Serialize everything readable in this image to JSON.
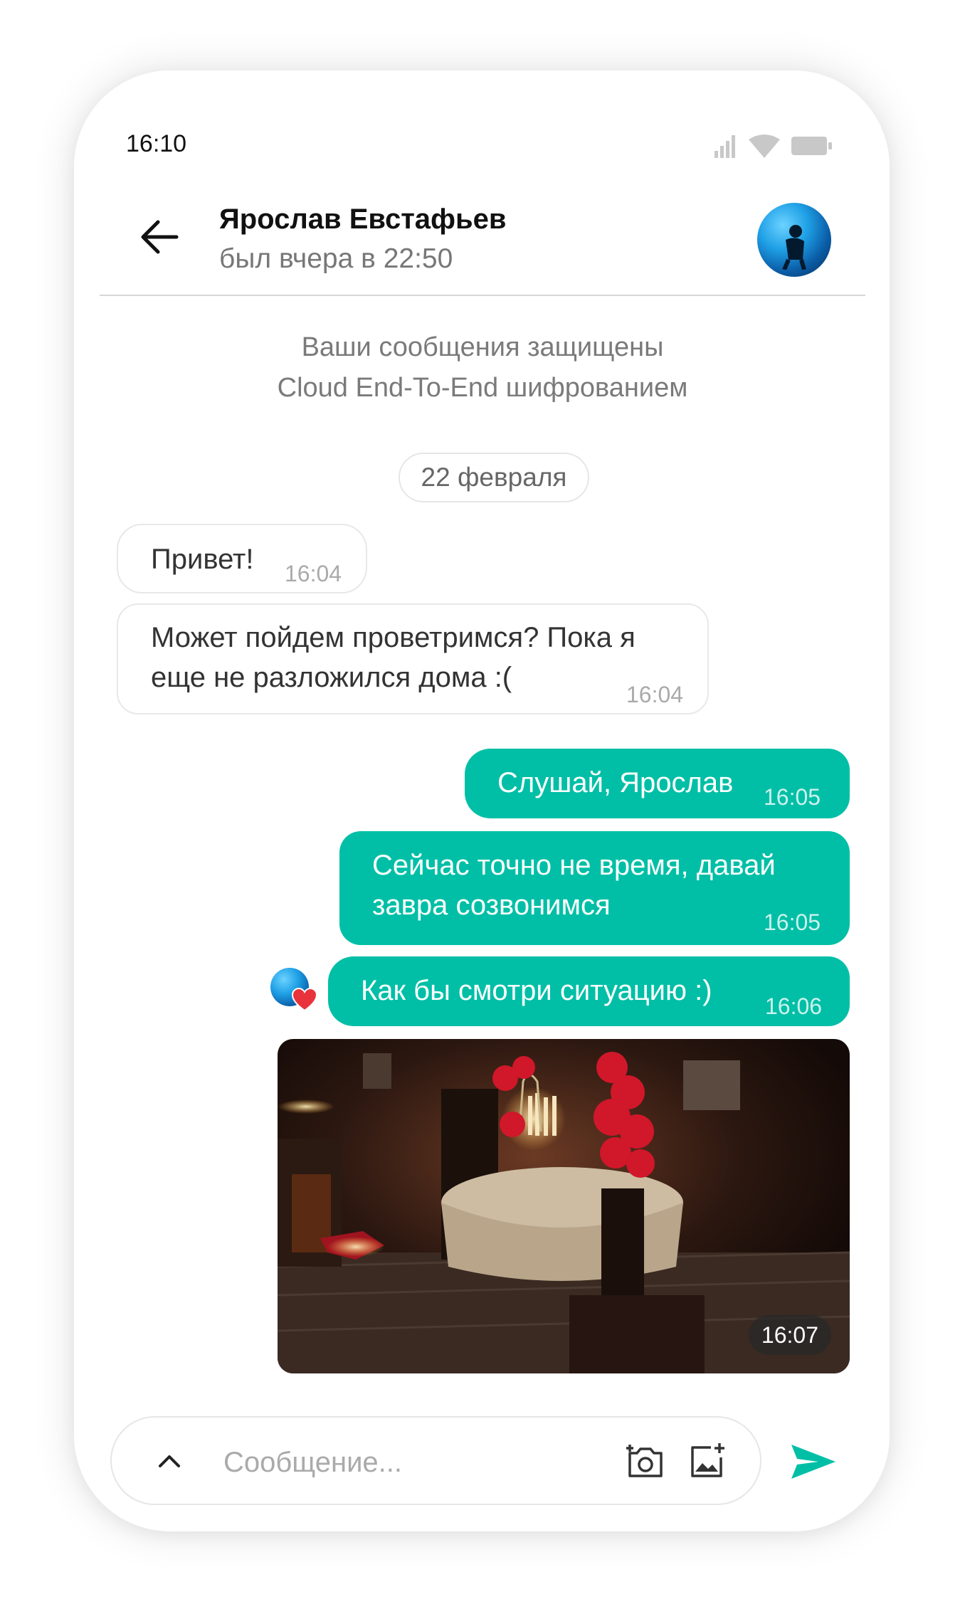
{
  "status_bar": {
    "time": "16:10"
  },
  "header": {
    "contact_name": "Ярослав Евстафьев",
    "last_seen": "был вчера в 22:50"
  },
  "encryption_note": {
    "line1": "Ваши сообщения защищены",
    "line2": "Cloud End-To-End шифрованием"
  },
  "date_separator": "22 февраля",
  "messages": [
    {
      "direction": "incoming",
      "text": "Привет!",
      "time": "16:04"
    },
    {
      "direction": "incoming",
      "text_line1": "Может пойдем проветримся? Пока я",
      "text_line2": "еще не разложился дома :(",
      "time": "16:04"
    },
    {
      "direction": "outgoing",
      "text": "Слушай, Ярослав",
      "time": "16:05"
    },
    {
      "direction": "outgoing",
      "text_line1": "Сейчас точно не время, давай",
      "text_line2": "завра созвонимся",
      "time": "16:05"
    },
    {
      "direction": "outgoing",
      "text": "Как бы смотри ситуацию :)",
      "time": "16:06",
      "reaction": "heart"
    },
    {
      "direction": "outgoing",
      "type": "photo",
      "time": "16:07"
    }
  ],
  "composer": {
    "placeholder": "Сообщение..."
  },
  "colors": {
    "accent": "#00bfa6",
    "reaction": "#e8333c"
  }
}
